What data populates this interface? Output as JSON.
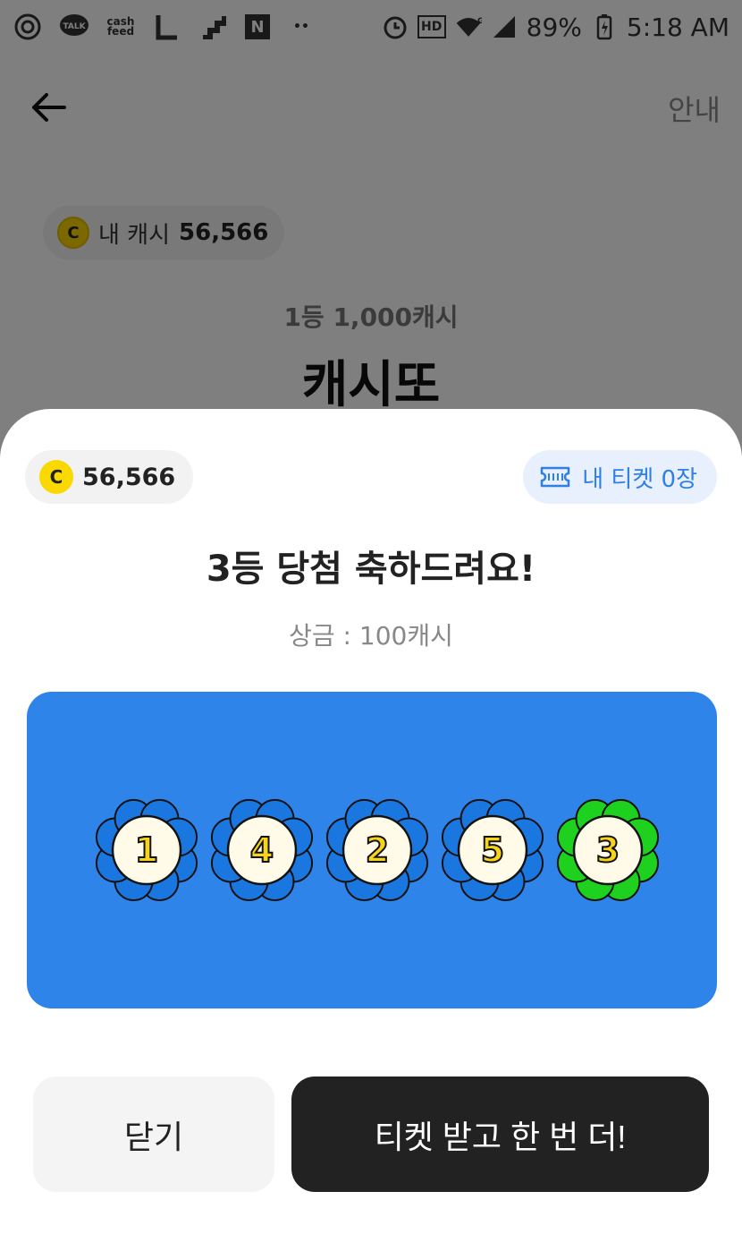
{
  "status_bar": {
    "battery": "89%",
    "time": "5:18 AM",
    "left_icons": [
      "settings-icon",
      "kakaotalk-icon",
      "cashfeed-icon",
      "l-app-icon",
      "stairs-app-icon",
      "naver-icon",
      "more-dots-icon"
    ],
    "right_icons": [
      "alarm-icon",
      "hd-icon",
      "wifi-icon",
      "signal-icon",
      "battery-icon"
    ],
    "labels": {
      "talk": "TALK",
      "cashfeed": "cash\nfeed",
      "naver": "N",
      "hd": "HD",
      "dots": "••",
      "network": "G"
    }
  },
  "background_page": {
    "info_label": "안내",
    "my_cash_label": "내 캐시",
    "my_cash_amount": "56,566",
    "prize_caption": "1등 1,000캐시",
    "title": "캐시또"
  },
  "sheet": {
    "cash_amount": "56,566",
    "coin_symbol": "C",
    "ticket_label": "내 티켓 0장",
    "congrats": "3등 당첨 축하드려요!",
    "prize_line": "상금 : 100캐시",
    "balls": [
      {
        "number": "1",
        "petal_color": "#1b77e0"
      },
      {
        "number": "4",
        "petal_color": "#1b77e0"
      },
      {
        "number": "2",
        "petal_color": "#1b77e0"
      },
      {
        "number": "5",
        "petal_color": "#1b77e0"
      },
      {
        "number": "3",
        "petal_color": "#1ed11e"
      }
    ],
    "close_label": "닫기",
    "retry_label": "티켓 받고 한 번 더!"
  },
  "colors": {
    "panel_blue": "#2f84e9",
    "ticket_blue": "#2f7fe8",
    "coin_yellow": "#f9d900",
    "dark_button": "#222222",
    "ball_number_yellow": "#f7d417"
  }
}
